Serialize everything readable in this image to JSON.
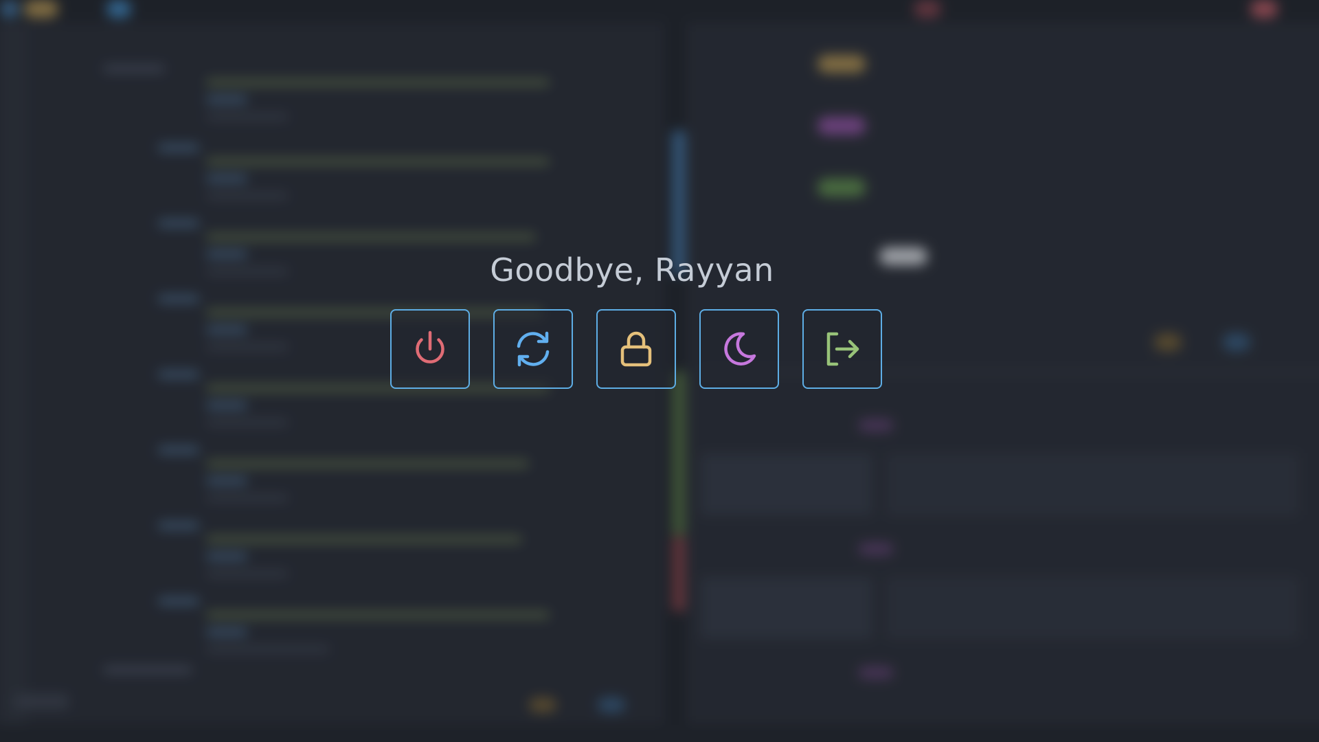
{
  "greeting": "Goodbye, Rayyan",
  "actions": [
    {
      "id": "shutdown",
      "icon": "power-icon",
      "color": "#e06c75",
      "label": ""
    },
    {
      "id": "reboot",
      "icon": "refresh-icon",
      "color": "#61afef",
      "label": ""
    },
    {
      "id": "lock",
      "icon": "lock-icon",
      "color": "#e5c07b",
      "label": ""
    },
    {
      "id": "suspend",
      "icon": "moon-icon",
      "color": "#c678dd",
      "label": ""
    },
    {
      "id": "logout",
      "icon": "logout-icon",
      "color": "#98c379",
      "label": ""
    }
  ],
  "colors": {
    "accent_border": "#5eaee6",
    "background": "#22262e",
    "text": "#c5ccd6"
  }
}
